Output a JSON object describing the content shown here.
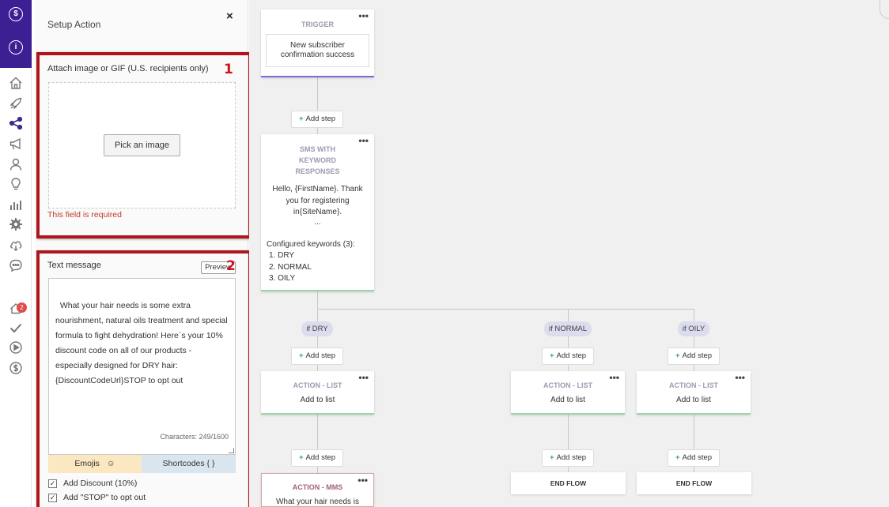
{
  "sidebar": {
    "icons": [
      "dollar-circle-icon",
      "info-circle-icon",
      "home-icon",
      "rocket-icon",
      "share-icon",
      "megaphone-icon",
      "user-icon",
      "lightbulb-icon",
      "bar-chart-icon",
      "gear-icon",
      "cloud-icon",
      "chat-icon",
      "notification-icon",
      "check-icon",
      "play-circle-icon",
      "dollar-circle-icon"
    ],
    "notification_badge": "2"
  },
  "panel": {
    "title": "Setup Action",
    "close_icon": "×",
    "section1": {
      "number": "1",
      "label": "Attach image or GIF (U.S. recipients only)",
      "pick_button": "Pick an image",
      "error": "This field is required"
    },
    "section2": {
      "number": "2",
      "label": "Text message",
      "preview_button": "Preview",
      "message": "What your hair needs is some extra nourishment, natural oils treatment and special formula to fight dehydration! Here`s your 10% discount code on all of our products - especially designed for DRY hair: {DiscountCodeUrl}STOP to opt out",
      "characters": "Characters: 249/1600",
      "emojis_tab": "Emojis",
      "emoji_glyph": "☺",
      "shortcodes_tab": "Shortcodes { }",
      "checkbox1_label": "Add Discount (10%)",
      "checkbox2_label": "Add \"STOP\" to opt out",
      "check_glyph": "✓"
    }
  },
  "flow": {
    "trigger": {
      "title": "TRIGGER",
      "body": "New subscriber confirmation success"
    },
    "add_step_label": "Add step",
    "sms": {
      "title": "SMS WITH KEYWORD RESPONSES",
      "body": "Hello, {FirstName}. Thank you for registering in{SiteName}.",
      "ellipsis": "...",
      "keywords_header": "Configured keywords (3):",
      "keywords": [
        "1. DRY",
        "2. NORMAL",
        "3. OILY"
      ]
    },
    "branches": [
      "if DRY",
      "if NORMAL",
      "if OILY"
    ],
    "action_list": {
      "title": "ACTION - LIST",
      "body": "Add to list"
    },
    "action_mms": {
      "title": "ACTION - MMS",
      "body": "What your hair needs is"
    },
    "end_flow": "END FLOW",
    "menu_dots": "•••"
  }
}
